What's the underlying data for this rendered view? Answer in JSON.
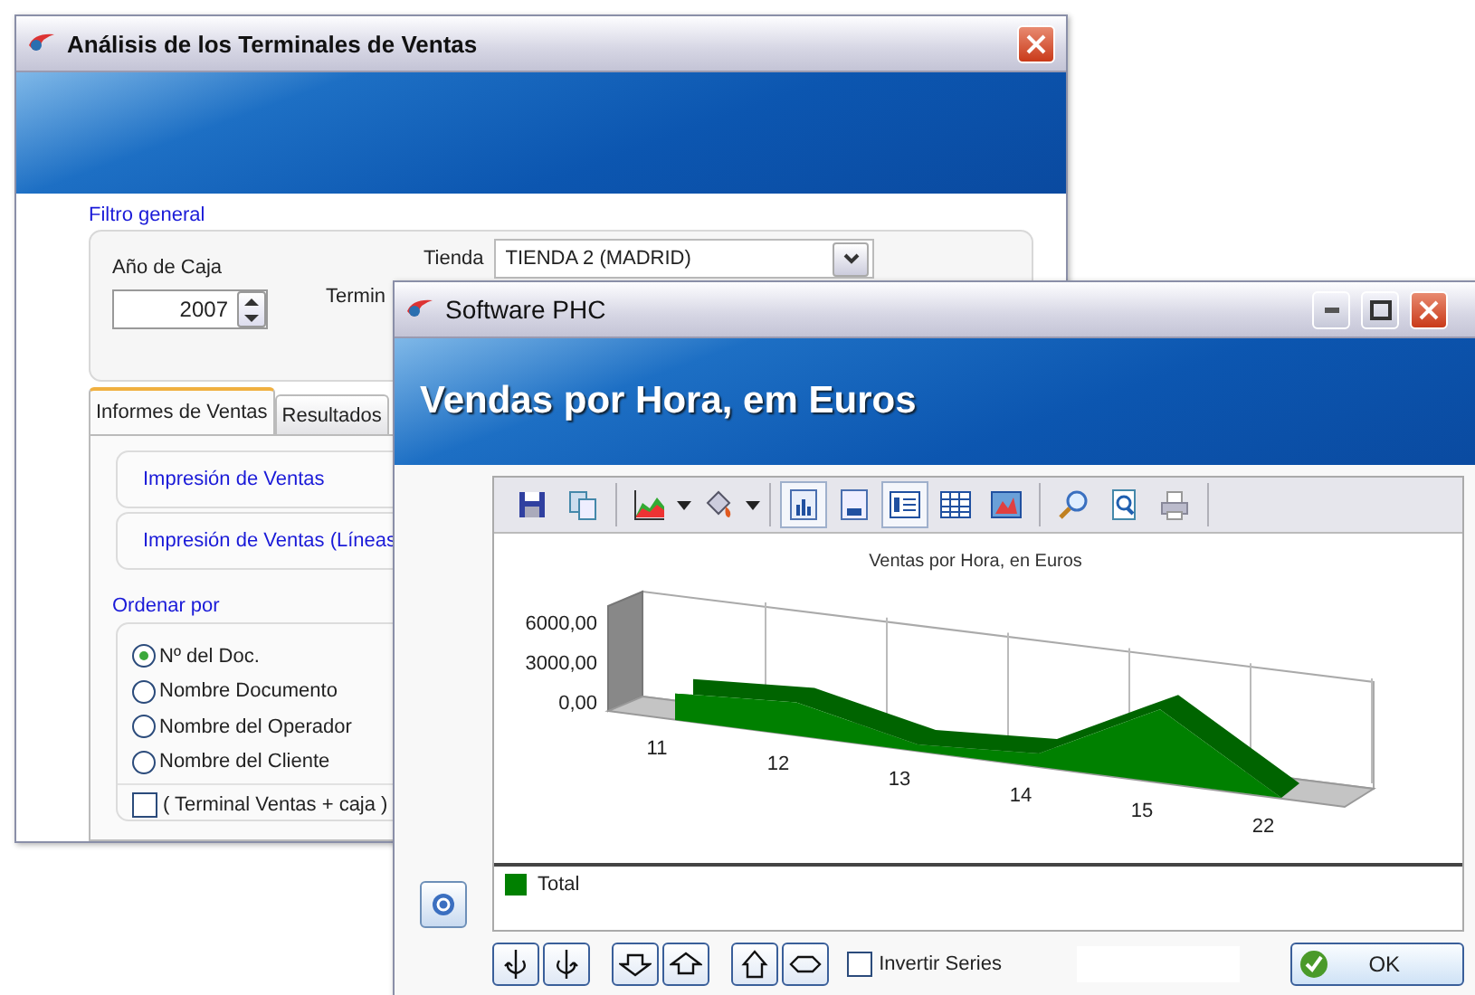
{
  "background_window": {
    "title": "Análisis de los Terminales de Ventas",
    "filter_group": {
      "heading": "Filtro general",
      "year_label": "Año de Caja",
      "year_value": "2007",
      "store_label": "Tienda",
      "store_value": "TIENDA 2 (MADRID)",
      "terminal_label": "Termin"
    },
    "tabs": [
      {
        "label": "Informes de Ventas",
        "selected": true
      },
      {
        "label": "Resultados",
        "selected": false
      }
    ],
    "report_links": [
      "Impresión de Ventas",
      "Impresión de Ventas (Líneas"
    ],
    "sort_group": {
      "heading": "Ordenar por",
      "options": [
        {
          "label": "Nº del Doc.",
          "selected": true
        },
        {
          "label": "Nombre Documento",
          "selected": false
        },
        {
          "label": "Nombre del Operador",
          "selected": false
        },
        {
          "label": "Nombre del Cliente",
          "selected": false
        }
      ],
      "terminal_checkbox": {
        "label": "( Terminal Ventas + caja )",
        "checked": false
      }
    }
  },
  "front_window": {
    "title": "Software PHC",
    "banner_title": "Vendas por Hora, em Euros",
    "view_buttons": [
      {
        "selected": true
      },
      {
        "selected": false
      },
      {
        "selected": true
      },
      {
        "selected": false
      },
      {
        "selected": false
      }
    ],
    "chart": {
      "title": "Ventas por Hora, en Euros",
      "y_axis_labels": [
        "6000,00",
        "3000,00",
        "0,00"
      ],
      "x_axis_labels": [
        "11",
        "12",
        "13",
        "14",
        "15",
        "22"
      ],
      "legend": [
        {
          "label": "Total",
          "color": "#008000"
        }
      ]
    },
    "invert_series": {
      "label": "Invertir Series",
      "checked": false
    },
    "ok_button": "OK"
  }
}
